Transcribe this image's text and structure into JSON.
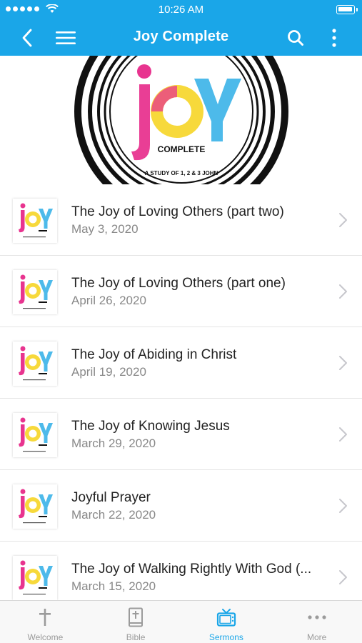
{
  "status_bar": {
    "time": "10:26 AM"
  },
  "nav": {
    "title": "Joy Complete"
  },
  "hero": {
    "logo_text": "JOY",
    "logo_subtitle": "COMPLETE",
    "logo_tagline": "A STUDY OF 1, 2 & 3 JOHN"
  },
  "sermons": [
    {
      "title": "The Joy of Loving Others (part two)",
      "date": "May 3, 2020"
    },
    {
      "title": "The Joy of Loving Others (part one)",
      "date": "April 26, 2020"
    },
    {
      "title": "The Joy of Abiding in Christ",
      "date": "April 19, 2020"
    },
    {
      "title": "The Joy of Knowing Jesus",
      "date": "March 29, 2020"
    },
    {
      "title": "Joyful Prayer",
      "date": "March 22, 2020"
    },
    {
      "title": "The Joy of Walking Rightly With God (...",
      "date": "March 15, 2020"
    }
  ],
  "tabs": [
    {
      "label": "Welcome",
      "icon": "cross-icon"
    },
    {
      "label": "Bible",
      "icon": "bible-icon"
    },
    {
      "label": "Sermons",
      "icon": "tv-icon",
      "active": true
    },
    {
      "label": "More",
      "icon": "more-dots-icon"
    }
  ],
  "colors": {
    "accent": "#1aa6e8",
    "joy_pink": "#e8348f",
    "joy_yellow": "#f6d526",
    "joy_blue": "#3ab3e8"
  }
}
